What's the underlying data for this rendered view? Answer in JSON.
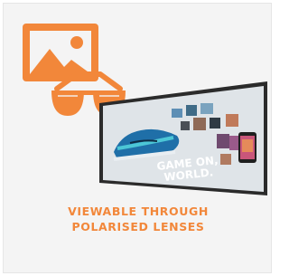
{
  "card": {
    "caption_line1": "VIEWABLE THROUGH",
    "caption_line2": "POLARISED LENSES",
    "accent_color": "#f2873a"
  },
  "icons": {
    "image_icon": "image-icon",
    "sunglasses_icon": "sunglasses-icon"
  },
  "display": {
    "headline_line1": "GAME ON,",
    "headline_line2": "WORLD."
  }
}
